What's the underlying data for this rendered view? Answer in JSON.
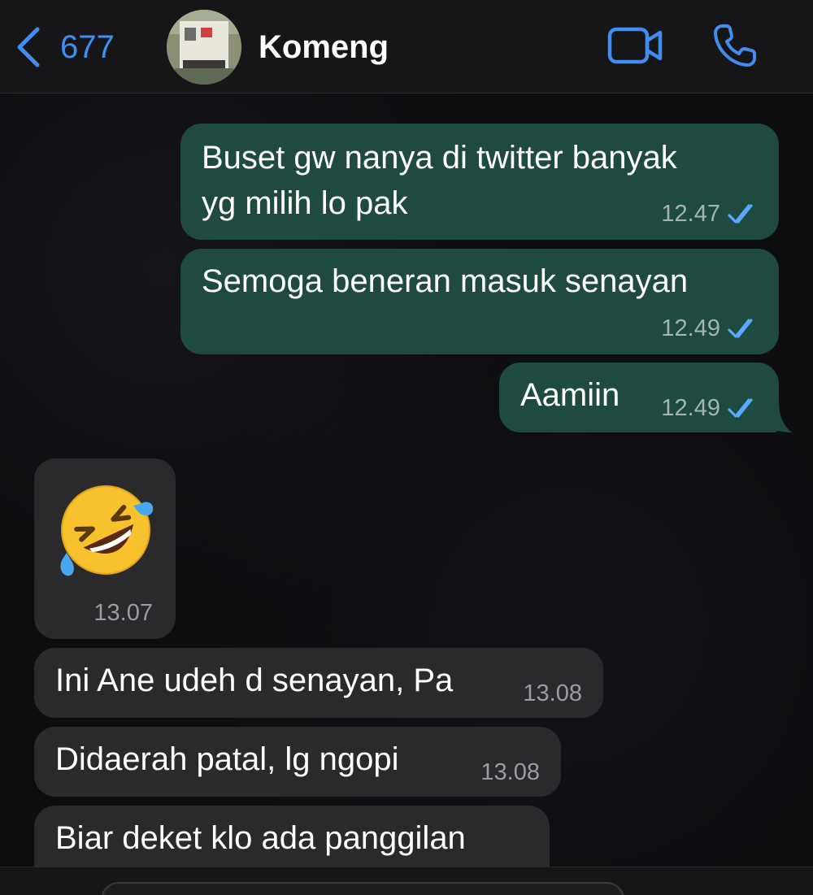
{
  "header": {
    "back_count": "677",
    "contact_name": "Komeng",
    "accent_color": "#3f8ef0"
  },
  "icons": {
    "back": "chevron-left-icon",
    "video": "video-camera-icon",
    "phone": "phone-icon",
    "read_receipt": "double-check-icon"
  },
  "messages": [
    {
      "direction": "outgoing",
      "text": "Buset gw nanya di twitter banyak\nyg milih lo pak",
      "time": "12.47",
      "read": true
    },
    {
      "direction": "outgoing",
      "text": "Semoga beneran masuk senayan",
      "time": "12.49",
      "read": true
    },
    {
      "direction": "outgoing",
      "text": "Aamiin",
      "time": "12.49",
      "read": true
    },
    {
      "direction": "incoming",
      "emoji": "rolling-on-the-floor-laughing",
      "time": "13.07"
    },
    {
      "direction": "incoming",
      "text": "Ini Ane udeh d senayan, Pa",
      "time": "13.08"
    },
    {
      "direction": "incoming",
      "text": "Didaerah patal, lg ngopi",
      "time": "13.08"
    },
    {
      "direction": "incoming",
      "text": "Biar deket klo ada panggilan",
      "time": ""
    }
  ],
  "colors": {
    "outgoing_bubble": "#1e4a3f",
    "incoming_bubble": "#2a2a2d",
    "read_tick": "#5aa8ff"
  }
}
